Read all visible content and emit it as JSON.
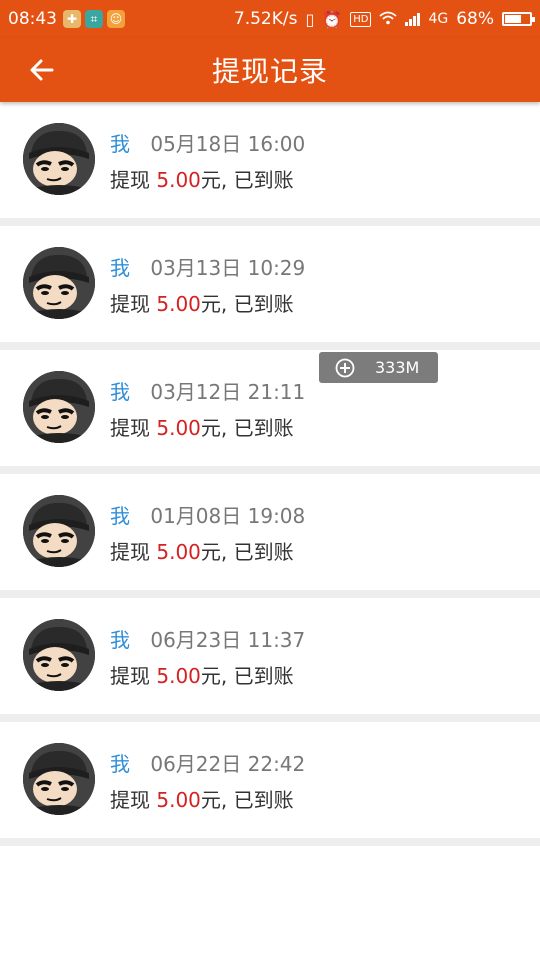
{
  "status_bar": {
    "time": "08:43",
    "speed": "7.52K/s",
    "network": "4G",
    "battery_text": "68%",
    "battery_level": 0.68
  },
  "app_bar": {
    "title": "提现记录",
    "back_icon": "arrow-left-icon"
  },
  "records": [
    {
      "user": "我",
      "time": "05月18日 16:00",
      "prefix": "提现 ",
      "amount": "5.00",
      "suffix": "元, 已到账"
    },
    {
      "user": "我",
      "time": "03月13日 10:29",
      "prefix": "提现 ",
      "amount": "5.00",
      "suffix": "元, 已到账"
    },
    {
      "user": "我",
      "time": "03月12日 21:11",
      "prefix": "提现 ",
      "amount": "5.00",
      "suffix": "元, 已到账"
    },
    {
      "user": "我",
      "time": "01月08日 19:08",
      "prefix": "提现 ",
      "amount": "5.00",
      "suffix": "元, 已到账"
    },
    {
      "user": "我",
      "time": "06月23日 11:37",
      "prefix": "提现 ",
      "amount": "5.00",
      "suffix": "元, 已到账"
    },
    {
      "user": "我",
      "time": "06月22日 22:42",
      "prefix": "提现 ",
      "amount": "5.00",
      "suffix": "元, 已到账"
    }
  ],
  "memory_badge": {
    "label": "333M",
    "icon": "boost-plus-icon"
  },
  "colors": {
    "primary": "#e35212",
    "user_name": "#2f8fd8",
    "amount": "#d42222",
    "divider": "#eeeeee"
  }
}
